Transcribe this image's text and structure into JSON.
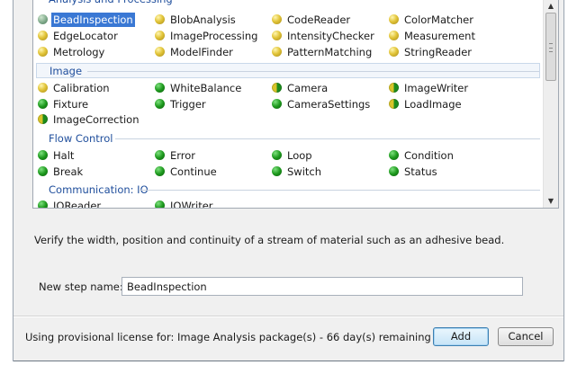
{
  "groups": {
    "analysis": {
      "label": "Analysis and Processing",
      "items": [
        {
          "label": "BeadInspection",
          "icon": "gray"
        },
        {
          "label": "BlobAnalysis",
          "icon": "yellow"
        },
        {
          "label": "CodeReader",
          "icon": "yellow"
        },
        {
          "label": "ColorMatcher",
          "icon": "yellow"
        },
        {
          "label": "EdgeLocator",
          "icon": "yellow"
        },
        {
          "label": "ImageProcessing",
          "icon": "yellow"
        },
        {
          "label": "IntensityChecker",
          "icon": "yellow"
        },
        {
          "label": "Measurement",
          "icon": "yellow"
        },
        {
          "label": "Metrology",
          "icon": "yellow"
        },
        {
          "label": "ModelFinder",
          "icon": "yellow"
        },
        {
          "label": "PatternMatching",
          "icon": "yellow"
        },
        {
          "label": "StringReader",
          "icon": "yellow"
        }
      ]
    },
    "image": {
      "label": "Image",
      "items": [
        {
          "label": "Calibration",
          "icon": "yellow"
        },
        {
          "label": "WhiteBalance",
          "icon": "green"
        },
        {
          "label": "Camera",
          "icon": "half"
        },
        {
          "label": "ImageWriter",
          "icon": "half"
        },
        {
          "label": "Fixture",
          "icon": "green"
        },
        {
          "label": "Trigger",
          "icon": "green"
        },
        {
          "label": "CameraSettings",
          "icon": "green"
        },
        {
          "label": "LoadImage",
          "icon": "half"
        },
        {
          "label": "ImageCorrection",
          "icon": "half"
        }
      ]
    },
    "flow": {
      "label": "Flow Control",
      "items": [
        {
          "label": "Halt",
          "icon": "green"
        },
        {
          "label": "Error",
          "icon": "green"
        },
        {
          "label": "Loop",
          "icon": "green"
        },
        {
          "label": "Condition",
          "icon": "green"
        },
        {
          "label": "Break",
          "icon": "green"
        },
        {
          "label": "Continue",
          "icon": "green"
        },
        {
          "label": "Switch",
          "icon": "green"
        },
        {
          "label": "Status",
          "icon": "green"
        }
      ]
    },
    "comm": {
      "label": "Communication: IO",
      "items": [
        {
          "label": "IOReader",
          "icon": "green"
        },
        {
          "label": "IOWriter",
          "icon": "green"
        }
      ]
    }
  },
  "selected_item": "BeadInspection",
  "description": "Verify the width, position and continuity of a stream of material such as an adhesive bead.",
  "step_name": {
    "label": "New step name:",
    "value": "BeadInspection"
  },
  "license_text": "Using provisional license for: Image Analysis package(s) - 66 day(s) remaining",
  "buttons": {
    "add": "Add",
    "cancel": "Cancel"
  },
  "scrollbar": {
    "up": "▲",
    "down": "▼"
  },
  "colors": {
    "group_header": "#1f4e9c",
    "selection": "#3a78d4",
    "default_button_border": "#3c7fb1"
  }
}
